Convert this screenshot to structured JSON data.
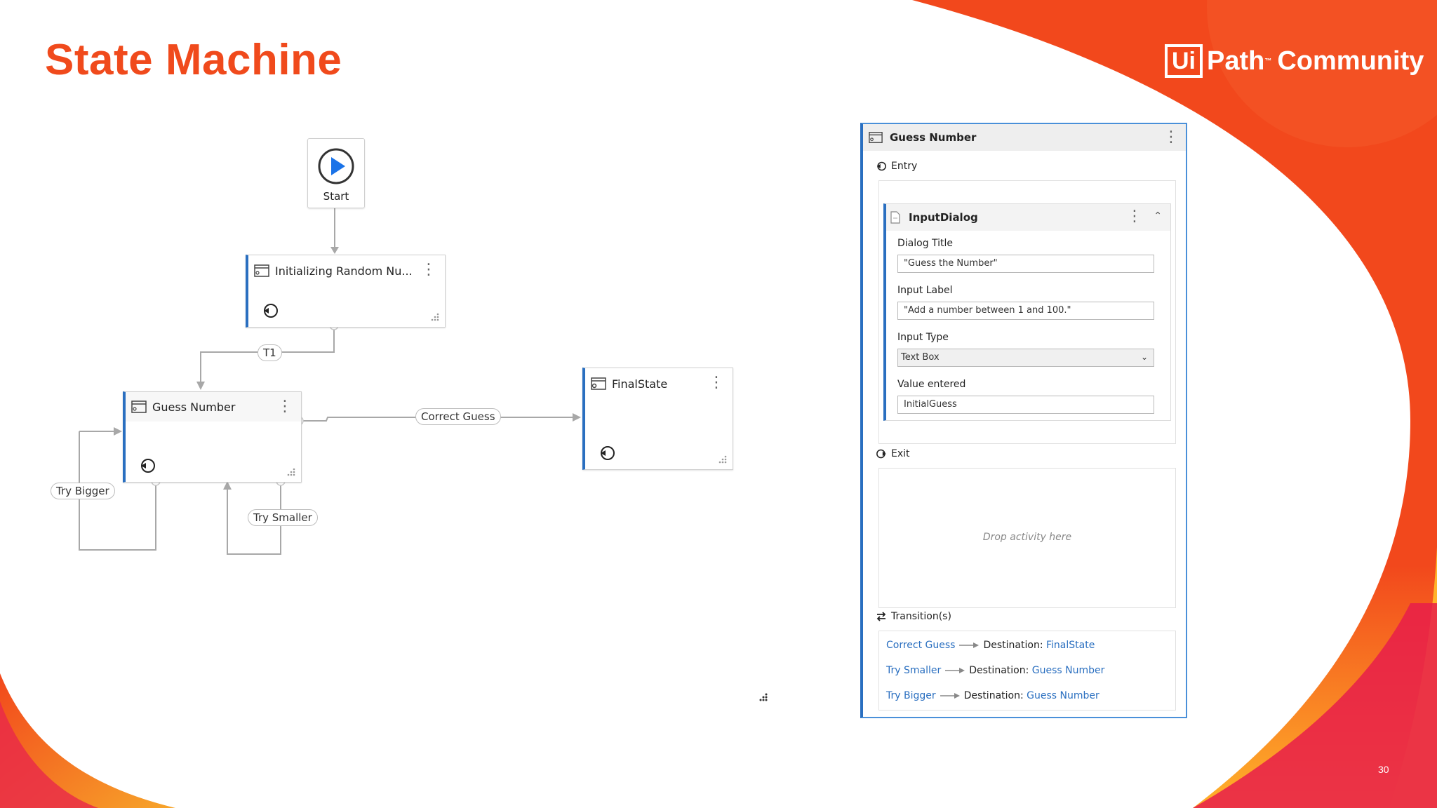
{
  "slide": {
    "title": "State Machine",
    "logo_box": "Ui",
    "logo_rest": "Path",
    "logo_tm": "™",
    "logo_word": "Community",
    "page_number": "30"
  },
  "colors": {
    "accent": "#f04a1c",
    "state_border": "#2a6fc0",
    "link": "#2a6fc0"
  },
  "canvas": {
    "start_label": "Start",
    "states": {
      "init": {
        "title": "Initializing Random Nu..."
      },
      "guess": {
        "title": "Guess Number"
      },
      "final": {
        "title": "FinalState"
      }
    },
    "transitions": {
      "t1": "T1",
      "correct": "Correct Guess",
      "bigger": "Try Bigger",
      "smaller": "Try Smaller"
    }
  },
  "panel": {
    "title": "Guess Number",
    "entry_label": "Entry",
    "activity": {
      "title": "InputDialog",
      "dialog_title_label": "Dialog Title",
      "dialog_title_value": "\"Guess the Number\"",
      "input_label_label": "Input Label",
      "input_label_value": "\"Add a number between 1 and 100.\"",
      "input_type_label": "Input Type",
      "input_type_value": "Text Box",
      "value_entered_label": "Value entered",
      "value_entered_value": "InitialGuess"
    },
    "exit_label": "Exit",
    "drop_hint": "Drop activity here",
    "transitions_label": "Transition(s)",
    "transitions": [
      {
        "name": "Correct Guess",
        "dest_label": "Destination:",
        "dest": "FinalState"
      },
      {
        "name": "Try Smaller",
        "dest_label": "Destination:",
        "dest": "Guess Number"
      },
      {
        "name": "Try Bigger",
        "dest_label": "Destination:",
        "dest": "Guess Number"
      }
    ]
  }
}
